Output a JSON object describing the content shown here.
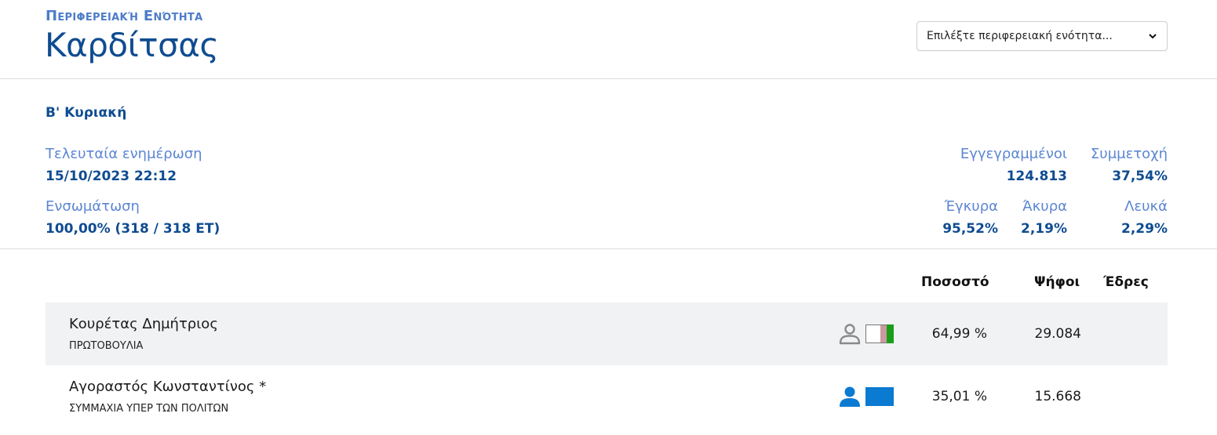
{
  "header": {
    "region_label": "Περιφερειακή Ενότητα",
    "region_name": "Καρδίτσας",
    "select_placeholder": "Επιλέξτε περιφερειακή ενότητα..."
  },
  "info": {
    "round": "Β' Κυριακή",
    "last_update_label": "Τελευταία ενημέρωση",
    "last_update_value": "15/10/2023 22:12",
    "integration_label": "Ενσωμάτωση",
    "integration_value": "100,00% (318 / 318 ΕΤ)",
    "registered_label": "Εγγεγραμμένοι",
    "registered_value": "124.813",
    "turnout_label": "Συμμετοχή",
    "turnout_value": "37,54%",
    "valid_label": "Έγκυρα",
    "valid_value": "95,52%",
    "invalid_label": "Άκυρα",
    "invalid_value": "2,19%",
    "blank_label": "Λευκά",
    "blank_value": "2,29%"
  },
  "table": {
    "headers": {
      "percent": "Ποσοστό",
      "votes": "Ψήφοι",
      "seats": "Έδρες"
    },
    "rows": [
      {
        "name": "Κουρέτας Δημήτριος",
        "party": "ΠΡΩΤΟΒΟΥΛΙΑ",
        "percent": "64,99 %",
        "votes": "29.084",
        "seats": "",
        "icon": "person-outline-icon",
        "flag_colors": [
          "#ffffff",
          "#c99aa0",
          "#1a9e1a"
        ],
        "icon_color": "#8a8a8a"
      },
      {
        "name": "Αγοραστός Κωνσταντίνος *",
        "party": "ΣΥΜΜΑΧΙΑ ΥΠΕΡ ΤΩΝ ΠΟΛΙΤΩΝ",
        "percent": "35,01 %",
        "votes": "15.668",
        "seats": "",
        "icon": "person-filled-icon",
        "flag_colors": [
          "#0b7ad1"
        ],
        "icon_color": "#0b7ad1"
      }
    ]
  },
  "colors": {
    "title_blue": "#0f4c91",
    "label_blue": "#5c86d2",
    "row_shade": "#f1f2f4"
  }
}
